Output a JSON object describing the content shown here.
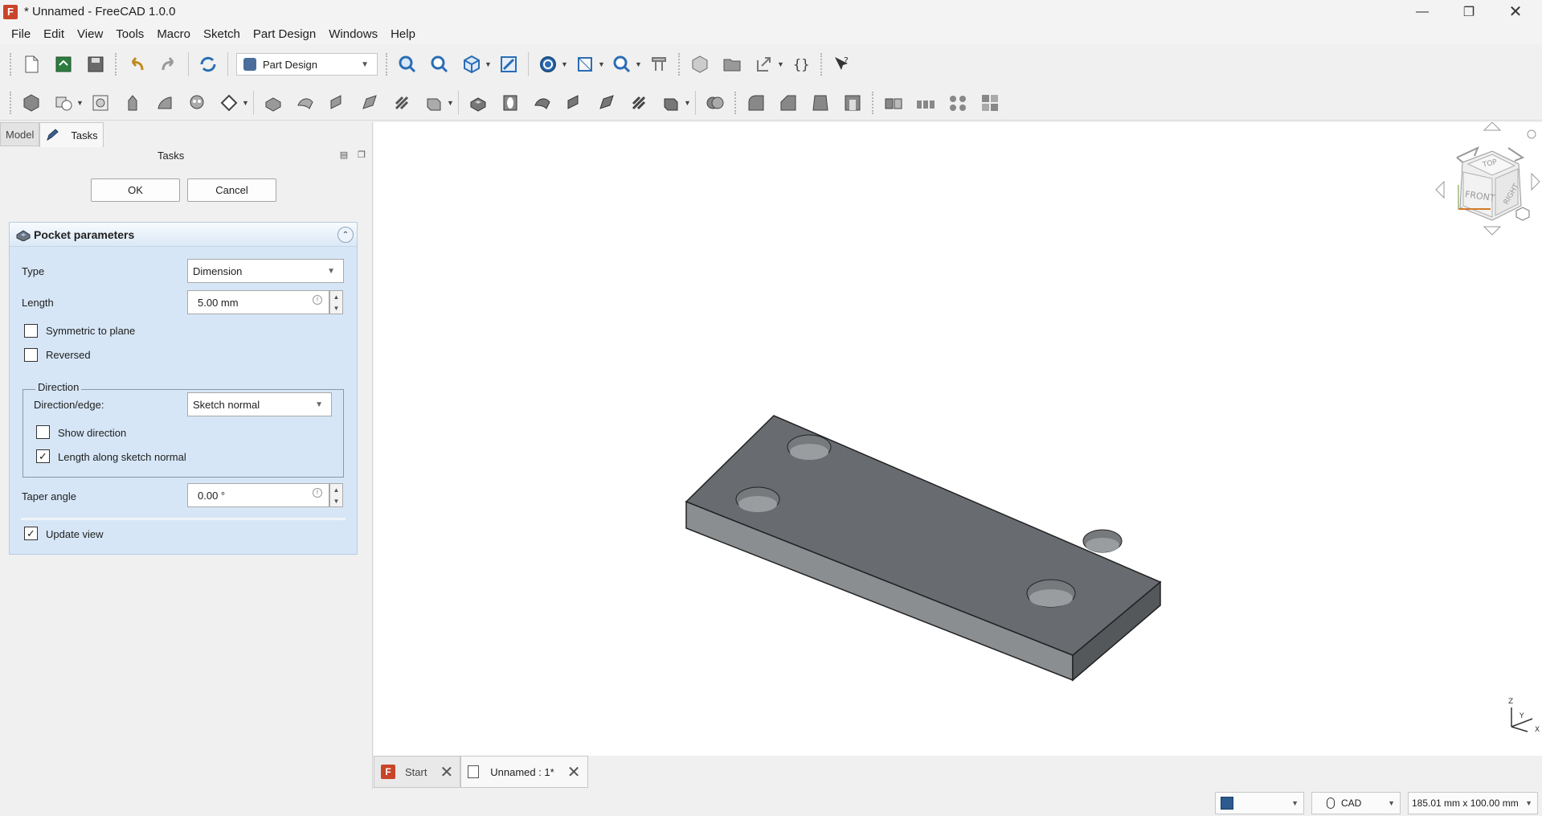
{
  "window": {
    "title": "* Unnamed - FreeCAD 1.0.0",
    "app_logo": "F",
    "controls": [
      "minimize",
      "restore",
      "close"
    ]
  },
  "menu": [
    "File",
    "Edit",
    "View",
    "Tools",
    "Macro",
    "Sketch",
    "Part Design",
    "Windows",
    "Help"
  ],
  "toolbar": {
    "workbench": "Part Design"
  },
  "combo_view": {
    "tabs": [
      "Model",
      "Tasks"
    ],
    "panel_title": "Tasks",
    "ok_label": "OK",
    "cancel_label": "Cancel"
  },
  "pocket": {
    "header": "Pocket parameters",
    "type_label": "Type",
    "type_value": "Dimension",
    "length_label": "Length",
    "length_value": "5.00 mm",
    "symmetric_label": "Symmetric to plane",
    "symmetric_checked": false,
    "reversed_label": "Reversed",
    "reversed_checked": false,
    "direction_group": "Direction",
    "direction_edge_label": "Direction/edge:",
    "direction_edge_value": "Sketch normal",
    "show_direction_label": "Show direction",
    "show_direction_checked": false,
    "length_along_label": "Length along sketch normal",
    "length_along_checked": true,
    "taper_label": "Taper angle",
    "taper_value": "0.00 °",
    "update_view_label": "Update view",
    "update_view_checked": true
  },
  "navcube": {
    "faces": [
      "TOP",
      "FRONT",
      "RIGHT"
    ]
  },
  "axis_labels": [
    "Z",
    "Y",
    "X"
  ],
  "doc_tabs": [
    {
      "label": "Start",
      "active": false
    },
    {
      "label": "Unnamed : 1*",
      "active": true
    }
  ],
  "status": {
    "nav_style": "CAD",
    "dimensions": "185.01 mm x 100.00 mm"
  },
  "colors": {
    "taskbox_bg": "#d6e6f6",
    "model_top": "#686c70",
    "model_front": "#8a8d90",
    "model_side": "#54575a"
  }
}
